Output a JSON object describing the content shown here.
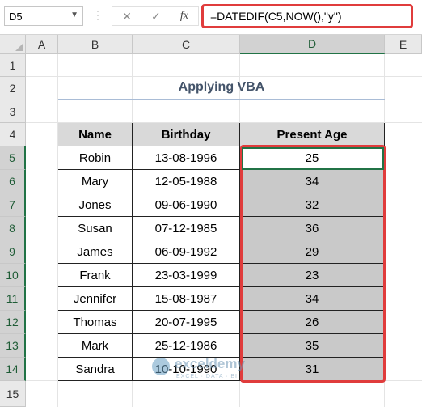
{
  "formula_bar": {
    "name_box": "D5",
    "cancel_icon": "✕",
    "enter_icon": "✓",
    "fx_label": "fx",
    "formula": "=DATEDIF(C5,NOW(),\"y\")"
  },
  "columns": [
    "A",
    "B",
    "C",
    "D",
    "E"
  ],
  "rows": [
    "1",
    "2",
    "3",
    "4",
    "5",
    "6",
    "7",
    "8",
    "9",
    "10",
    "11",
    "12",
    "13",
    "14",
    "15"
  ],
  "title": "Applying VBA",
  "table": {
    "headers": [
      "Name",
      "Birthday",
      "Present Age"
    ],
    "rows": [
      [
        "Robin",
        "13-08-1996",
        "25"
      ],
      [
        "Mary",
        "12-05-1988",
        "34"
      ],
      [
        "Jones",
        "09-06-1990",
        "32"
      ],
      [
        "Susan",
        "07-12-1985",
        "36"
      ],
      [
        "James",
        "06-09-1992",
        "29"
      ],
      [
        "Frank",
        "23-03-1999",
        "23"
      ],
      [
        "Jennifer",
        "15-08-1987",
        "34"
      ],
      [
        "Thomas",
        "20-07-1995",
        "26"
      ],
      [
        "Mark",
        "25-12-1986",
        "35"
      ],
      [
        "Sandra",
        "10-10-1990",
        "31"
      ]
    ]
  },
  "watermark": {
    "name": "exceldemy",
    "tag": "EXCEL · DATA · BI"
  },
  "colors": {
    "highlight": "#e03c3c",
    "selection": "#217346",
    "title": "#44546a"
  }
}
